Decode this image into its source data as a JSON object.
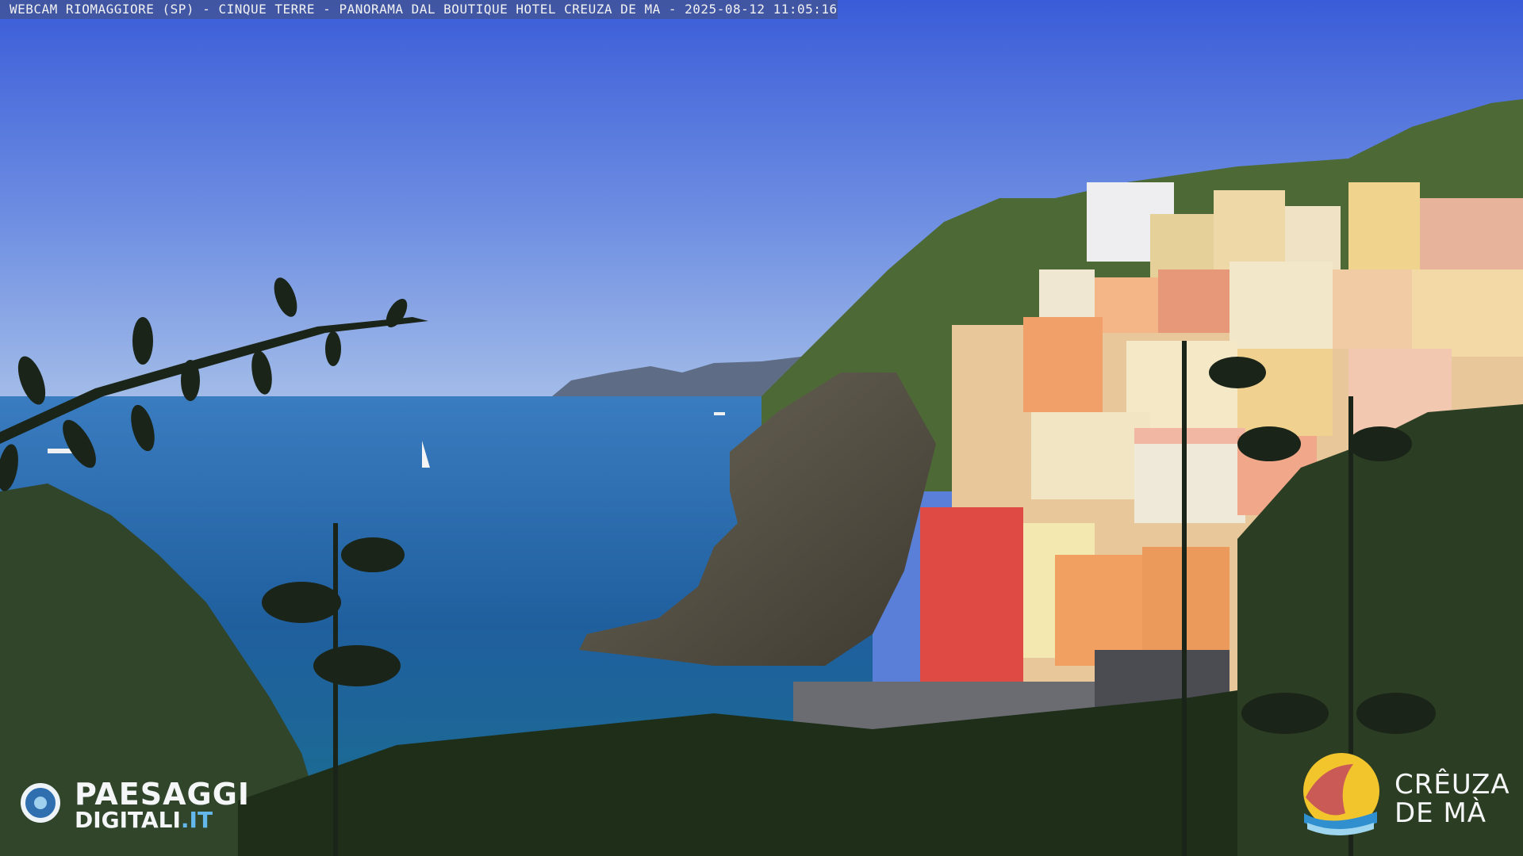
{
  "webcam": {
    "caption": "WEBCAM RIOMAGGIORE (SP) - CINQUE TERRE - PANORAMA DAL BOUTIQUE HOTEL CREUZA DE MA - 2025-08-12 11:05:16"
  },
  "logos": {
    "left_line1": "PAESAGGI",
    "left_line2": "DIGITALI",
    "left_tld": ".IT",
    "right_line1": "CRÊUZA",
    "right_line2": "DE MÀ"
  },
  "colors": {
    "sky_top": "#3d5fd6",
    "sky_bottom": "#8fb0e6",
    "sea": "#2a6fa8",
    "foliage": "#1e2a18",
    "hill": "#4f6b3a",
    "rock": "#5e5548"
  }
}
